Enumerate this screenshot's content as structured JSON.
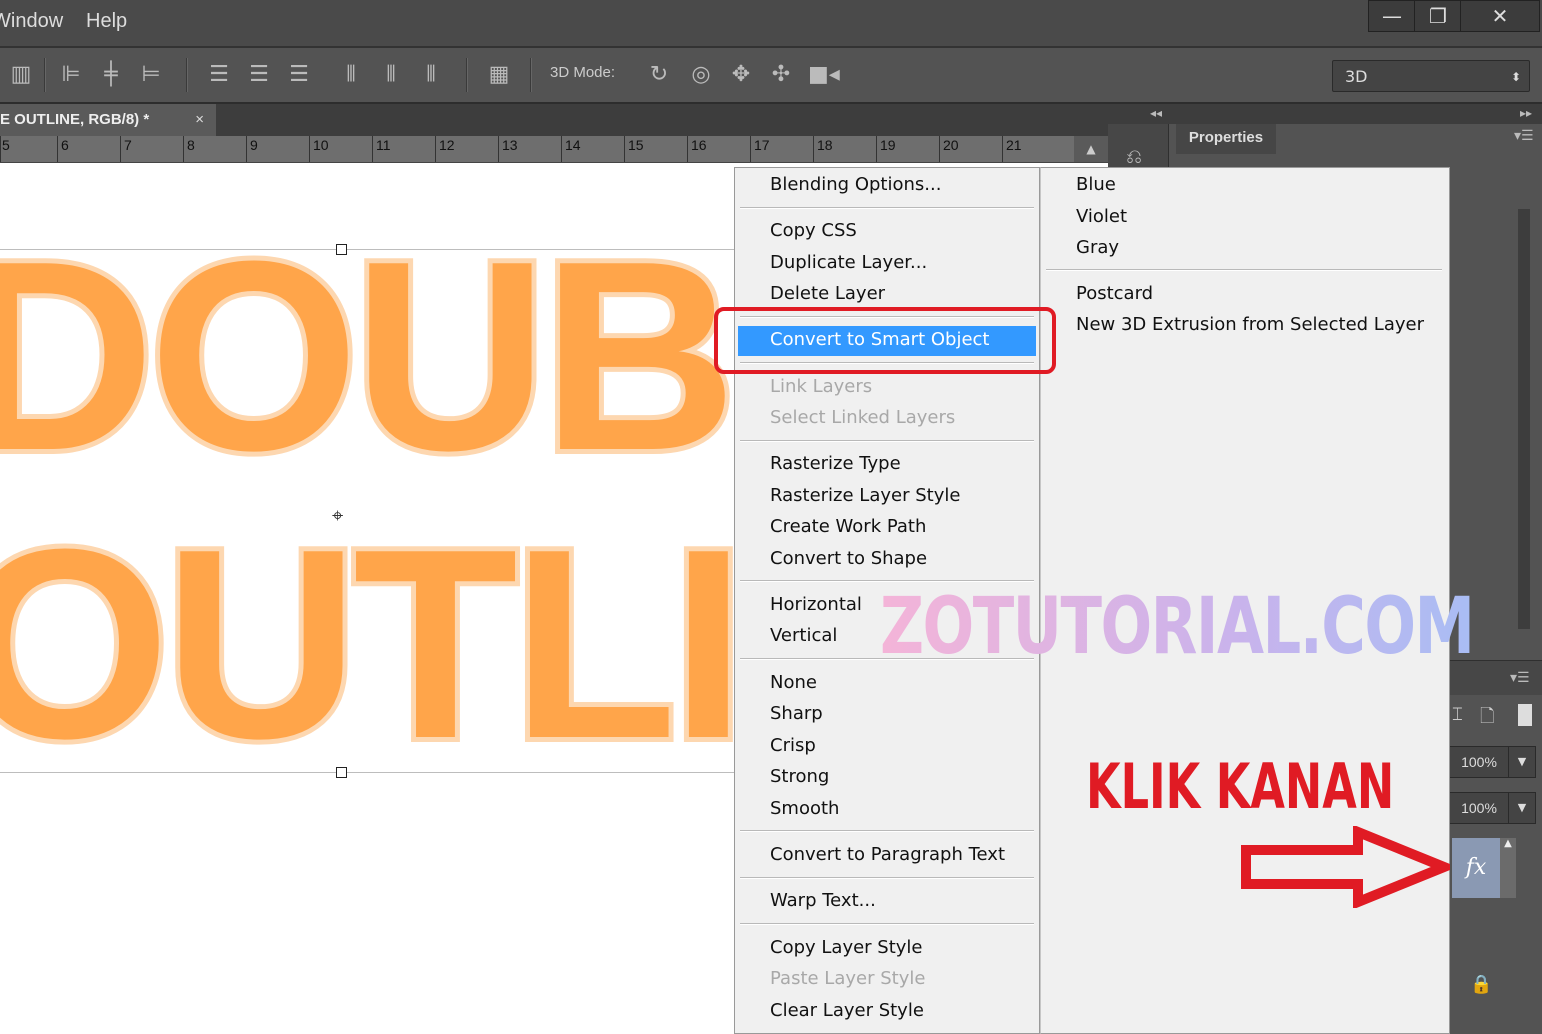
{
  "menubar": {
    "items": [
      "Window",
      "Help"
    ]
  },
  "window_controls": {
    "minimize": "—",
    "restore": "❐",
    "close": "✕"
  },
  "options_bar": {
    "mode_3d_label": "3D Mode:",
    "workspace_value": "3D",
    "icons": [
      "align-top-edges-icon",
      "align-vertical-centers-icon",
      "align-bottom-edges-icon",
      "align-left-edges-icon",
      "align-horizontal-centers-icon",
      "align-right-edges-icon",
      "distribute-top-icon",
      "distribute-vertical-centers-icon",
      "distribute-bottom-icon",
      "distribute-left-icon",
      "distribute-horizontal-centers-icon",
      "distribute-right-icon",
      "auto-align-icon",
      "rotate-3d-icon",
      "roll-3d-icon",
      "drag-3d-icon",
      "slide-3d-icon",
      "scale-3d-icon"
    ]
  },
  "document": {
    "tab_title": "E OUTLINE, RGB/8) *",
    "tab_close": "×"
  },
  "ruler": {
    "labels": [
      "5",
      "6",
      "7",
      "8",
      "9",
      "10",
      "11",
      "12",
      "13",
      "14",
      "15",
      "16",
      "17",
      "18",
      "19",
      "20",
      "21"
    ]
  },
  "canvas": {
    "line1": "DOUBLE",
    "line2": "OUTLINE",
    "text_color": "#ffa54a",
    "stroke_color": "#fdd7b0"
  },
  "panels": {
    "properties_tab": "Properties",
    "opacity": "100%",
    "fill": "100%",
    "fx_label": "fx"
  },
  "context_menu": {
    "column1": [
      {
        "label": "Blending Options...",
        "enabled": true
      },
      {
        "sep": true
      },
      {
        "label": "Copy CSS",
        "enabled": true
      },
      {
        "label": "Duplicate Layer...",
        "enabled": true
      },
      {
        "label": "Delete Layer",
        "enabled": true
      },
      {
        "sep": true
      },
      {
        "label": "Convert to Smart Object",
        "enabled": true,
        "highlighted": true
      },
      {
        "sep": true
      },
      {
        "label": "Link Layers",
        "enabled": false
      },
      {
        "label": "Select Linked Layers",
        "enabled": false
      },
      {
        "sep": true
      },
      {
        "label": "Rasterize Type",
        "enabled": true
      },
      {
        "label": "Rasterize Layer Style",
        "enabled": true
      },
      {
        "label": "Create Work Path",
        "enabled": true
      },
      {
        "label": "Convert to Shape",
        "enabled": true
      },
      {
        "sep": true
      },
      {
        "label": "Horizontal",
        "enabled": true
      },
      {
        "label": "Vertical",
        "enabled": true
      },
      {
        "sep": true
      },
      {
        "label": "None",
        "enabled": true
      },
      {
        "label": "Sharp",
        "enabled": true
      },
      {
        "label": "Crisp",
        "enabled": true
      },
      {
        "label": "Strong",
        "enabled": true
      },
      {
        "label": "Smooth",
        "enabled": true
      },
      {
        "sep": true
      },
      {
        "label": "Convert to Paragraph Text",
        "enabled": true
      },
      {
        "sep": true
      },
      {
        "label": "Warp Text...",
        "enabled": true
      },
      {
        "sep": true
      },
      {
        "label": "Copy Layer Style",
        "enabled": true
      },
      {
        "label": "Paste Layer Style",
        "enabled": false
      },
      {
        "label": "Clear Layer Style",
        "enabled": true
      }
    ],
    "column2": [
      {
        "label": "Blue",
        "enabled": true
      },
      {
        "label": "Violet",
        "enabled": true
      },
      {
        "label": "Gray",
        "enabled": true
      },
      {
        "sep": true
      },
      {
        "label": "Postcard",
        "enabled": true
      },
      {
        "label": "New 3D Extrusion from Selected Layer",
        "enabled": true
      }
    ],
    "highlight_color": "#3399ff"
  },
  "annotations": {
    "watermark": "ZOTUTORIAL.COM",
    "instruction": "KLIK KANAN",
    "accent_color": "#e01b24"
  }
}
